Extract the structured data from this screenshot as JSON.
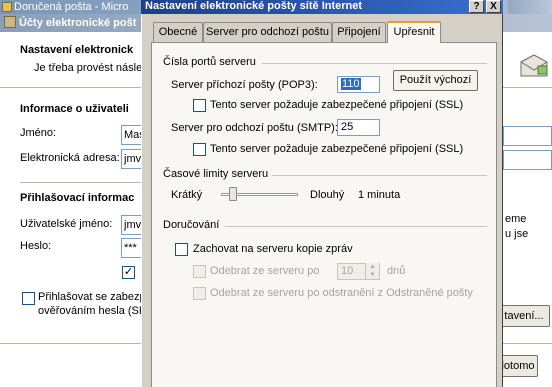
{
  "background_window": {
    "title": "Doručená pošta - Micro"
  },
  "wizard": {
    "title": "Účty elektronické pošt",
    "heading": "Nastavení elektronick",
    "subheading": "Je třeba provést násle",
    "section_user": "Informace o uživateli",
    "name_label": "Jméno:",
    "name_value": "Mas",
    "email_label": "Elektronická adresa:",
    "email_value": "jmv",
    "section_login": "Přihlašovací informac",
    "username_label": "Uživatelské jméno:",
    "username_value": "jmv",
    "password_label": "Heslo:",
    "password_value": "***",
    "remember_checked": "✓",
    "spa_line1": "Přihlašovat se zabezp",
    "spa_line2": "ověřováním hesla (SP",
    "right_text_1": "eme",
    "right_text_2": "u jse",
    "more_settings_button": "tavení...",
    "next_button": "lotomo"
  },
  "dialog": {
    "title": "Nastavení elektronické pošty sítě Internet",
    "help_button": "?",
    "close_button": "X",
    "tabs": [
      {
        "label": "Obecné"
      },
      {
        "label": "Server pro odchozí poštu"
      },
      {
        "label": "Připojení"
      },
      {
        "label": "Upřesnit"
      }
    ],
    "active_tab": "Upřesnit",
    "ports_section": "Čísla portů serveru",
    "pop3_label": "Server příchozí pošty (POP3):",
    "pop3_value": "110",
    "use_default_button": "Použít výchozí",
    "ssl_in_label": "Tento server požaduje zabezpečené připojení (SSL)",
    "smtp_label": "Server pro odchozí poštu (SMTP):",
    "smtp_value": "25",
    "ssl_out_label": "Tento server požaduje zabezpečené připojení (SSL)",
    "timeouts_section": "Časové limity serveru",
    "timeout_short": "Krátký",
    "timeout_long": "Dlouhý",
    "timeout_value": "1 minuta",
    "timeout_slider_fraction": 0.12,
    "delivery_section": "Doručování",
    "keep_copy_label": "Zachovat na serveru kopie zpráv",
    "remove_after_label": "Odebrat ze serveru po",
    "remove_after_days": "10",
    "days_unit": "dnů",
    "remove_deleted_label": "Odebrat ze serveru po odstranění z Odstraněné pošty"
  },
  "colors": {
    "dialog_title_start": "#1c3f8a",
    "dialog_title_end": "#3a6ed0",
    "tab_active_accent": "#e0a030",
    "selection": "#316ac5"
  }
}
